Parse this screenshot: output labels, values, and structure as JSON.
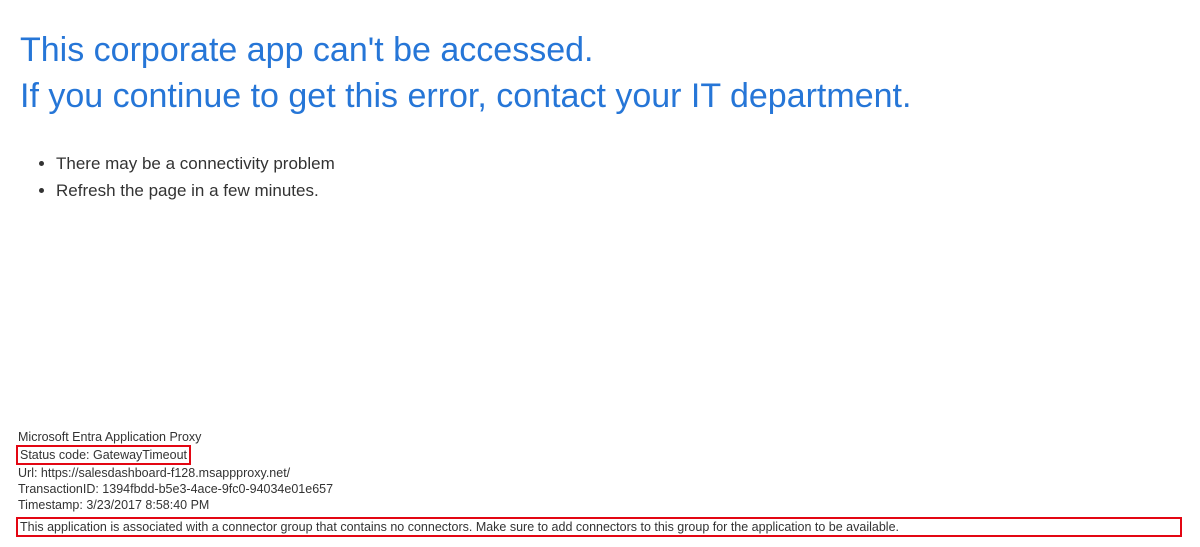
{
  "heading": {
    "line1": "This corporate app can't be accessed.",
    "line2": "If you continue to get this error, contact your IT department."
  },
  "suggestions": {
    "item1": "There may be a connectivity problem",
    "item2": "Refresh the page in a few minutes."
  },
  "details": {
    "product": "Microsoft Entra Application Proxy",
    "status_label": "Status code: ",
    "status_value": "GatewayTimeout",
    "url_label": "Url: ",
    "url_value": "https://salesdashboard-f128.msappproxy.net/",
    "transaction_label": "TransactionID: ",
    "transaction_value": "1394fbdd-b5e3-4ace-9fc0-94034e01e657",
    "timestamp_label": "Timestamp: ",
    "timestamp_value": "3/23/2017 8:58:40 PM",
    "message": "This application is associated with a connector group that contains no connectors. Make sure to add connectors to this group for the application to be available."
  }
}
